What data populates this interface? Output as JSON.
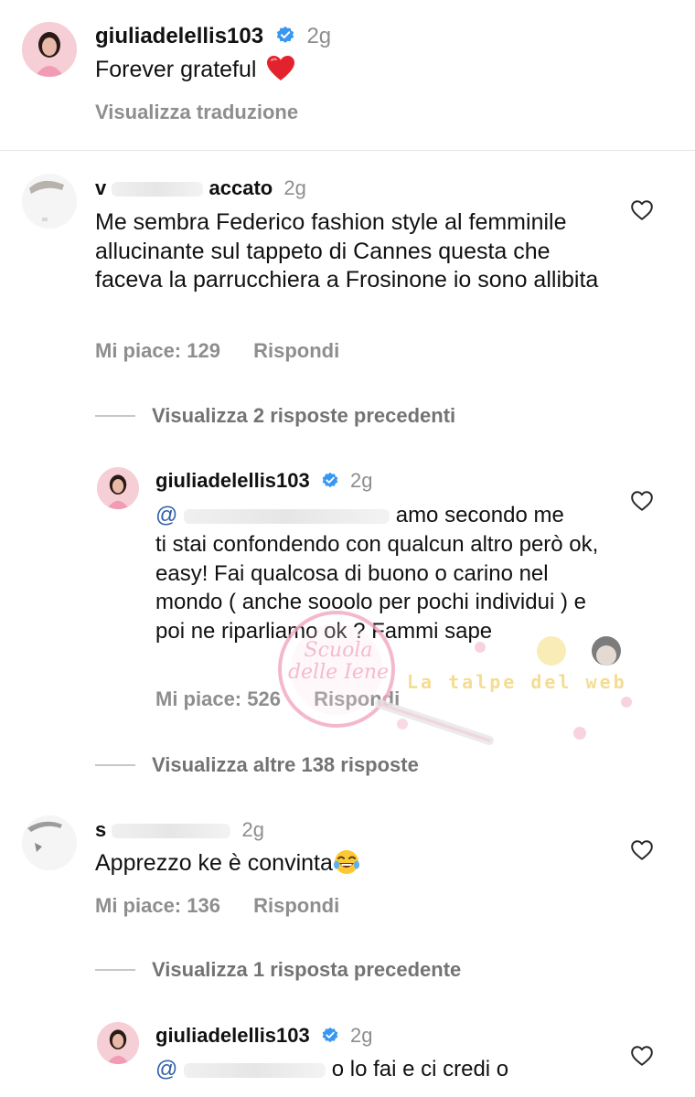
{
  "comment_1": {
    "username": "giuliadelellis103",
    "time": "2g",
    "text": "Forever grateful",
    "translate_label": "Visualizza traduzione"
  },
  "comment_2": {
    "username_visible": "v",
    "username_tail": "accato",
    "time": "2g",
    "text": "Me sembra Federico fashion style al femminile allucinante sul tappeto di Cannes questa che faceva la parrucchiera a Frosinone io sono allibita",
    "likes": "Mi piace: 129",
    "reply_label": "Rispondi",
    "view_previous": "Visualizza 2 risposte precedenti"
  },
  "reply_1": {
    "username": "giuliadelellis103",
    "time": "2g",
    "mention_visible": "@",
    "first_line_tail": "amo secondo me",
    "text": "ti stai confondendo con qualcun altro però ok, easy! Fai qualcosa di buono o carino nel mondo ( anche sooolo per pochi individui ) e poi ne riparliamo ok ? Fammi sape",
    "likes": "Mi piace: 526",
    "reply_label": "Rispondi",
    "view_more": "Visualizza altre 138 risposte"
  },
  "comment_3": {
    "username_visible": "s",
    "time": "2g",
    "text": "Apprezzo ke è convinta",
    "likes": "Mi piace: 136",
    "reply_label": "Rispondi",
    "view_previous": "Visualizza 1 risposta precedente"
  },
  "reply_2": {
    "username": "giuliadelellis103",
    "time": "2g",
    "mention_visible": "@",
    "first_line_tail": "o lo fai e ci credi o"
  },
  "watermark": {
    "script_text": "Scuola delle Iene",
    "tag_text": "La talpe del web"
  },
  "colors": {
    "verified": "#3897f0",
    "heart_red": "#e0245e",
    "meta_gray": "#8e8e8e",
    "watermark_pink": "#f1a6c0",
    "watermark_yellow": "#f3d77f"
  },
  "icons": {
    "verified": "verified-badge-icon",
    "heart": "heart-outline-icon",
    "red_heart": "red-heart-emoji",
    "laughing": "laughing-emoji"
  }
}
